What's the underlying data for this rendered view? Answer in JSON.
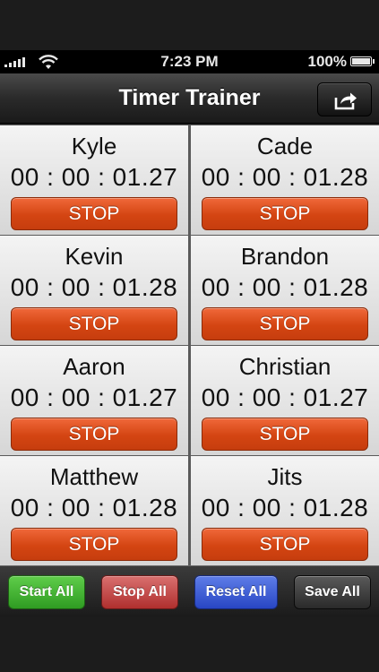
{
  "status_bar": {
    "time": "7:23 PM",
    "battery": "100%"
  },
  "navbar": {
    "title": "Timer Trainer",
    "share_icon": "share-icon"
  },
  "timers": [
    {
      "name": "Kyle",
      "time": "00 : 00 : 01.27",
      "button": "STOP"
    },
    {
      "name": "Cade",
      "time": "00 : 00 : 01.28",
      "button": "STOP"
    },
    {
      "name": "Kevin",
      "time": "00 : 00 : 01.28",
      "button": "STOP"
    },
    {
      "name": "Brandon",
      "time": "00 : 00 : 01.28",
      "button": "STOP"
    },
    {
      "name": "Aaron",
      "time": "00 : 00 : 01.27",
      "button": "STOP"
    },
    {
      "name": "Christian",
      "time": "00 : 00 : 01.27",
      "button": "STOP"
    },
    {
      "name": "Matthew",
      "time": "00 : 00 : 01.28",
      "button": "STOP"
    },
    {
      "name": "Jits",
      "time": "00 : 00 : 01.28",
      "button": "STOP"
    }
  ],
  "toolbar": {
    "start_all": "Start All",
    "stop_all": "Stop All",
    "reset_all": "Reset All",
    "save_all": "Save All"
  },
  "colors": {
    "stop_button": "#d44512",
    "start_all": "#3fae2e",
    "stop_all": "#c03e3d",
    "reset_all": "#3555d4",
    "save_all": "#3a3a3a"
  }
}
